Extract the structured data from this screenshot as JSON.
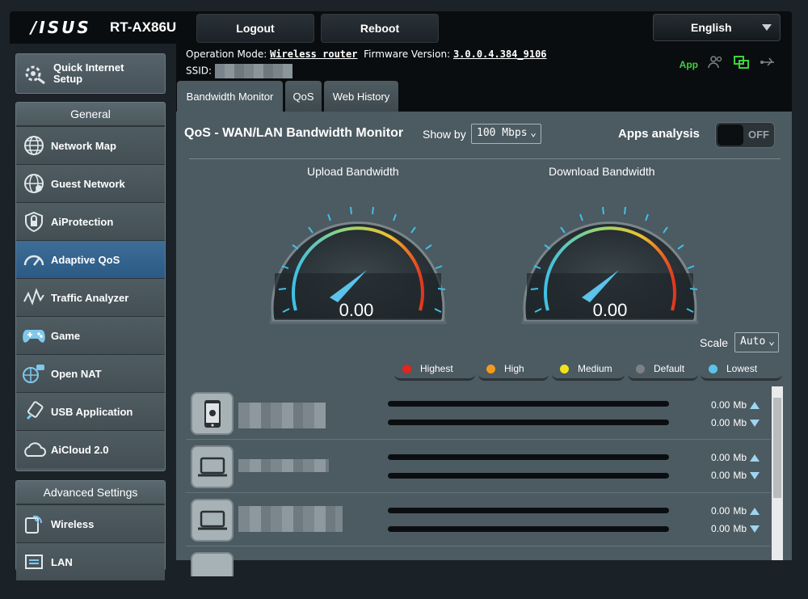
{
  "header": {
    "brand": "/ISUS",
    "model": "RT-AX86U",
    "logout_label": "Logout",
    "reboot_label": "Reboot",
    "language": "English"
  },
  "status": {
    "operation_mode_label": "Operation Mode:",
    "operation_mode_value": "Wireless router",
    "firmware_label": "Firmware Version:",
    "firmware_value": "3.0.0.4.384_9106",
    "ssid_label": "SSID:",
    "app_label": "App"
  },
  "sidebar": {
    "quick_setup": "Quick Internet Setup",
    "general_header": "General",
    "items": [
      {
        "label": "Network Map",
        "icon": "globe-icon"
      },
      {
        "label": "Guest Network",
        "icon": "guest-globe-icon"
      },
      {
        "label": "AiProtection",
        "icon": "shield-lock-icon"
      },
      {
        "label": "Adaptive QoS",
        "icon": "speedometer-icon",
        "active": true
      },
      {
        "label": "Traffic Analyzer",
        "icon": "traffic-graph-icon"
      },
      {
        "label": "Game",
        "icon": "gamepad-icon"
      },
      {
        "label": "Open NAT",
        "icon": "nat-icon"
      },
      {
        "label": "USB Application",
        "icon": "usb-icon"
      },
      {
        "label": "AiCloud 2.0",
        "icon": "cloud-icon"
      }
    ],
    "advanced_header": "Advanced Settings",
    "advanced_items": [
      {
        "label": "Wireless",
        "icon": "wireless-icon"
      },
      {
        "label": "LAN",
        "icon": "lan-icon"
      }
    ]
  },
  "tabs": [
    "Bandwidth Monitor",
    "QoS",
    "Web History"
  ],
  "monitor": {
    "title": "QoS - WAN/LAN Bandwidth Monitor",
    "show_by_label": "Show by",
    "show_by_value": "100 Mbps",
    "apps_analysis_label": "Apps analysis",
    "apps_analysis_state": "OFF",
    "upload_label": "Upload Bandwidth",
    "download_label": "Download Bandwidth",
    "upload_value": "0.00",
    "download_value": "0.00",
    "scale_label": "Scale",
    "scale_value": "Auto"
  },
  "legend": [
    {
      "label": "Highest",
      "color": "#e3261c"
    },
    {
      "label": "High",
      "color": "#f39a1e"
    },
    {
      "label": "Medium",
      "color": "#f1e21e"
    },
    {
      "label": "Default",
      "color": "#7c8184"
    },
    {
      "label": "Lowest",
      "color": "#5cc3ea"
    }
  ],
  "devices": [
    {
      "type": "phone-icon",
      "up": "0.00",
      "down": "0.00",
      "unit": "Mb"
    },
    {
      "type": "laptop-icon",
      "up": "0.00",
      "down": "0.00",
      "unit": "Mb"
    },
    {
      "type": "laptop-icon",
      "up": "0.00",
      "down": "0.00",
      "unit": "Mb"
    }
  ]
}
